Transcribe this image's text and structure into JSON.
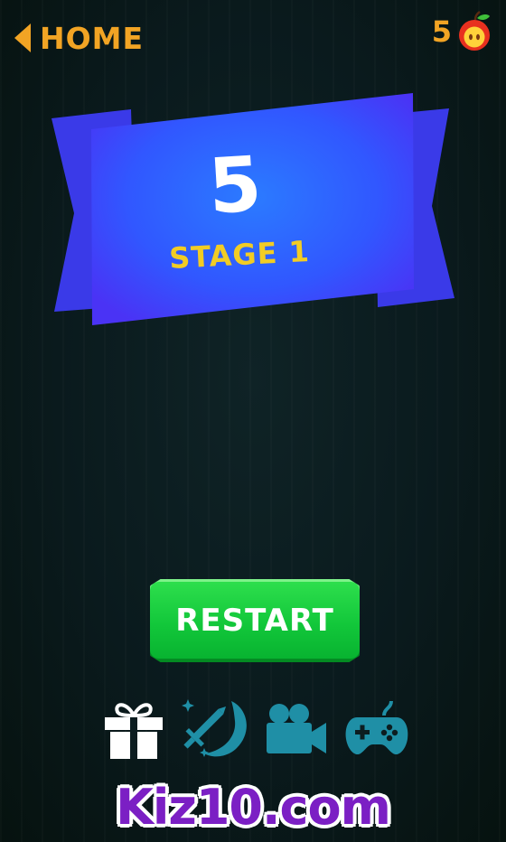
{
  "header": {
    "home_label": "HOME",
    "score": "5",
    "score_icon": "apple-icon"
  },
  "banner": {
    "level_number": "5",
    "stage_label": "STAGE 1"
  },
  "actions": {
    "restart_label": "RESTART"
  },
  "icon_bar": [
    {
      "name": "gift-icon",
      "color": "#ffffff"
    },
    {
      "name": "sword-moon-icon",
      "color": "#1f8fa6"
    },
    {
      "name": "video-camera-icon",
      "color": "#1f8fa6"
    },
    {
      "name": "gamepad-icon",
      "color": "#1f8fa6"
    }
  ],
  "footer": {
    "logo_text": "Kiz10.com"
  },
  "colors": {
    "accent_orange": "#f2a424",
    "stage_yellow": "#f2cc24",
    "banner_blue": "#3a4bff",
    "restart_green": "#12c73a",
    "icon_teal": "#1f8fa6",
    "logo_purple": "#7b1fc4"
  }
}
